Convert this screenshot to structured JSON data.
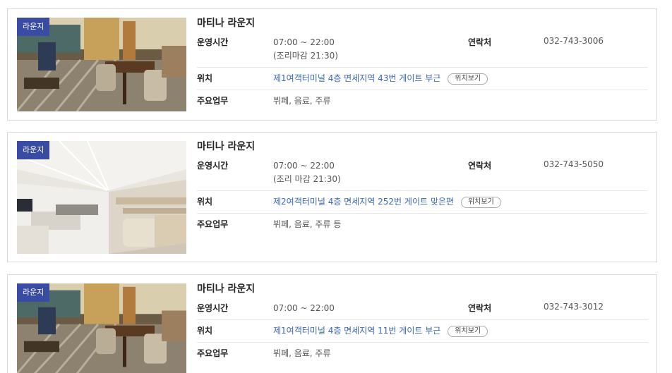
{
  "lounges": [
    {
      "tag": "라운지",
      "name": "마티나 라운지",
      "hours_label": "운영시간",
      "hours": "07:00 ~ 22:00",
      "hours_note": "(조리마감 21:30)",
      "contact_label": "연락처",
      "contact": "032-743-3006",
      "location_label": "위치",
      "location": "제1여객터미널 4층 면세지역 43번 게이트 부근",
      "map_button": "위치보기",
      "service_label": "주요업무",
      "service": "뷔페, 음료, 주류",
      "photo": "lounge-restaurant-photo"
    },
    {
      "tag": "라운지",
      "name": "마티나 라운지",
      "hours_label": "운영시간",
      "hours": "07:00 ~ 22:00",
      "hours_note": "(조리 마감 21:30)",
      "contact_label": "연락처",
      "contact": "032-743-5050",
      "location_label": "위치",
      "location": "제2여객터미널 4층 면세지역 252번 게이트 맞은편",
      "map_button": "위치보기",
      "service_label": "주요업무",
      "service": "뷔페, 음료, 주류 등",
      "photo": "lounge-hall-photo"
    },
    {
      "tag": "라운지",
      "name": "마티나 라운지",
      "hours_label": "운영시간",
      "hours": "07:00 ~ 22:00",
      "contact_label": "연락처",
      "contact": "032-743-3012",
      "location_label": "위치",
      "location": "제1여객터미널 4층 면세지역 11번 게이트 부근",
      "map_button": "위치보기",
      "service_label": "주요업무",
      "service": "뷔페, 음료, 주류",
      "photo": "lounge-restaurant-photo"
    }
  ],
  "colors": {
    "tag_bg": "#3a4ba3",
    "link": "#3a66b8",
    "border": "#d9d9d9"
  }
}
